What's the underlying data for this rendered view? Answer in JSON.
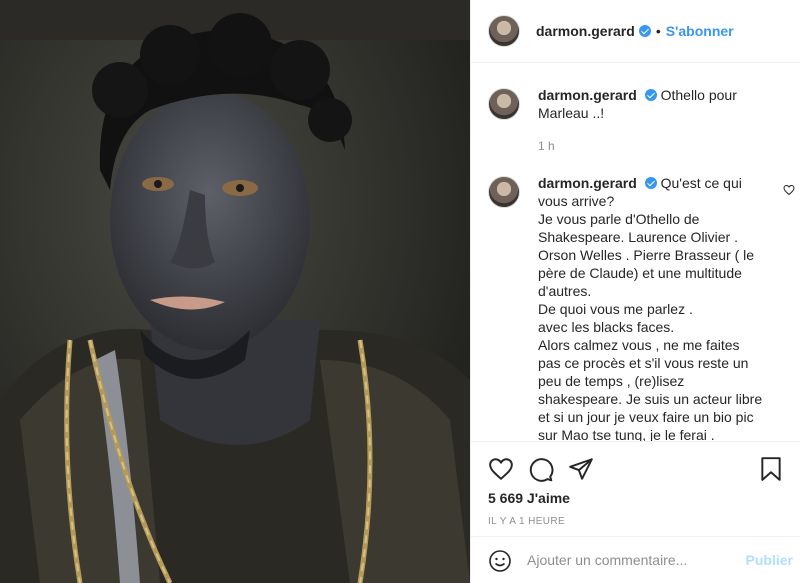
{
  "post": {
    "author": "darmon.gerard",
    "follow_label": "S'abonner",
    "separator": "•",
    "caption": "Othello pour Marleau ..!",
    "caption_time": "1 h",
    "reply_lines": [
      "Qu'est ce qui",
      "vous arrive?",
      "Je vous parle d'Othello de",
      "Shakespeare. Laurence Olivier .",
      "Orson Welles . Pierre Brasseur ( le",
      "père de Claude) et une multitude",
      "d'autres.",
      "De quoi vous me parlez .",
      "avec les blacks faces.",
      "Alors calmez vous , ne me faites",
      "pas ce procès et s'il vous reste un",
      "peu de temps , (re)lisez",
      "shakespeare. Je suis un acteur libre",
      "et si un jour je veux faire un bio pic",
      "sur Mao tse tung, je le ferai ."
    ],
    "likes": "5 669 J'aime",
    "posted_ago": "IL Y A 1 HEURE",
    "comment_placeholder": "Ajouter un commentaire...",
    "publish_label": "Publier"
  },
  "icons": [
    "heart-icon",
    "comment-icon",
    "share-icon",
    "bookmark-icon",
    "emoji-icon",
    "verified-icon"
  ],
  "colors": {
    "accent": "#3897f0",
    "publish_disabled": "#b2dffc",
    "muted": "#8e8e8e"
  }
}
